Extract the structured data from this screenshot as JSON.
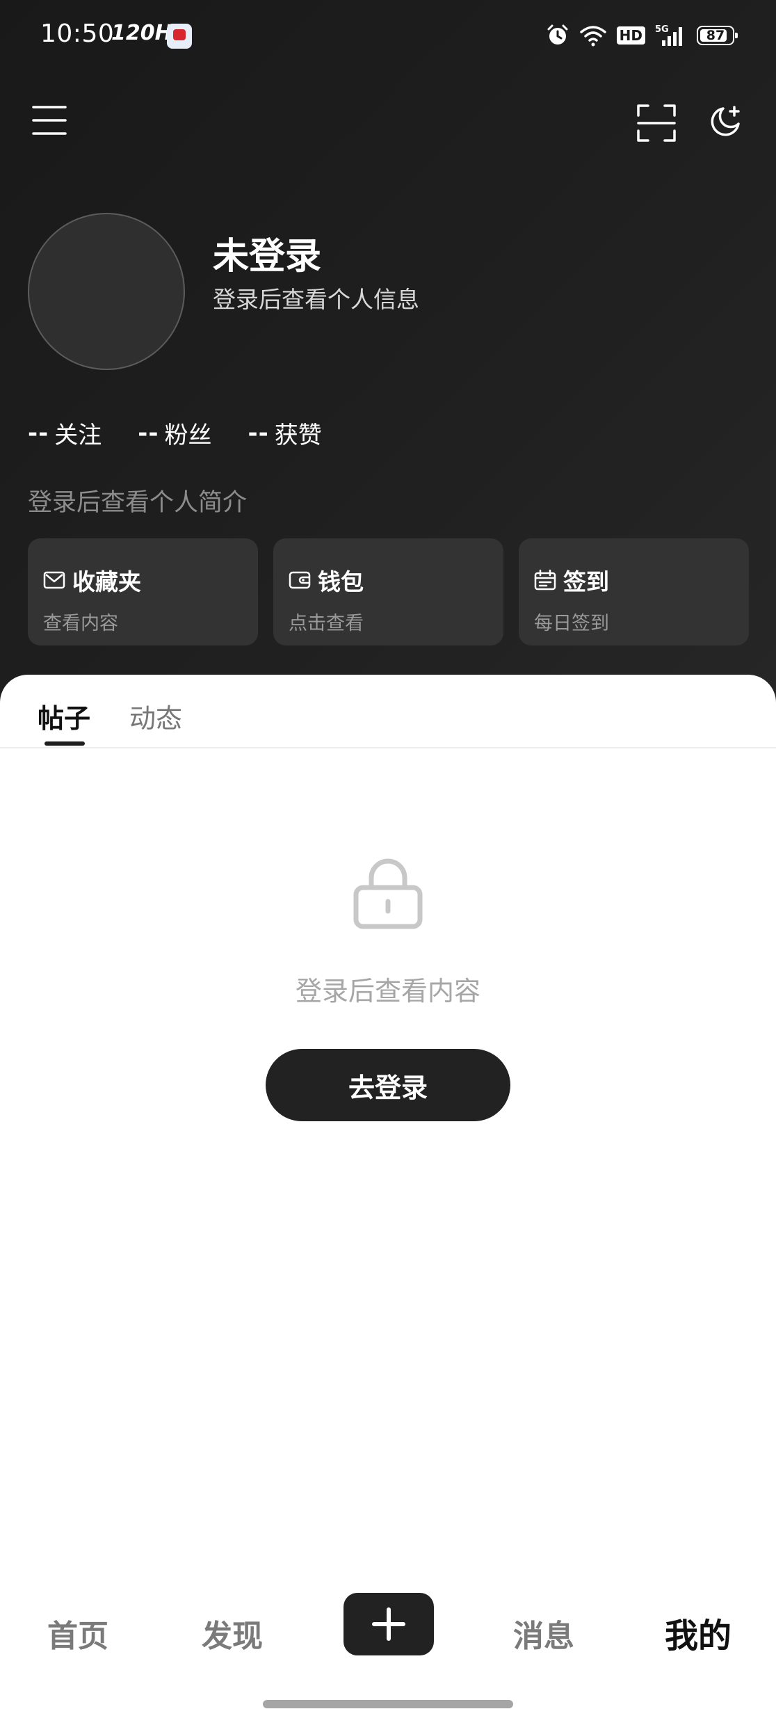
{
  "status_bar": {
    "time": "10:50",
    "refresh_rate": "120Hz",
    "battery": "87"
  },
  "profile": {
    "username": "未登录",
    "subtitle": "登录后查看个人信息",
    "stats": [
      {
        "value": "--",
        "label": "关注"
      },
      {
        "value": "--",
        "label": "粉丝"
      },
      {
        "value": "--",
        "label": "获赞"
      }
    ],
    "bio": "登录后查看个人简介"
  },
  "cards": [
    {
      "title": "收藏夹",
      "subtitle": "查看内容",
      "icon": "envelope-icon"
    },
    {
      "title": "钱包",
      "subtitle": "点击查看",
      "icon": "wallet-icon"
    },
    {
      "title": "签到",
      "subtitle": "每日签到",
      "icon": "calendar-icon"
    }
  ],
  "tabs": [
    {
      "label": "帖子",
      "active": true
    },
    {
      "label": "动态",
      "active": false
    }
  ],
  "empty_state": {
    "message": "登录后查看内容",
    "button_label": "去登录"
  },
  "bottom_nav": {
    "home": "首页",
    "discover": "发现",
    "messages": "消息",
    "mine": "我的"
  },
  "colors": {
    "header_bg": "#1e1e1e",
    "card_bg": "#333333",
    "accent_dark": "#222222",
    "muted_text": "#a6a6a6"
  }
}
